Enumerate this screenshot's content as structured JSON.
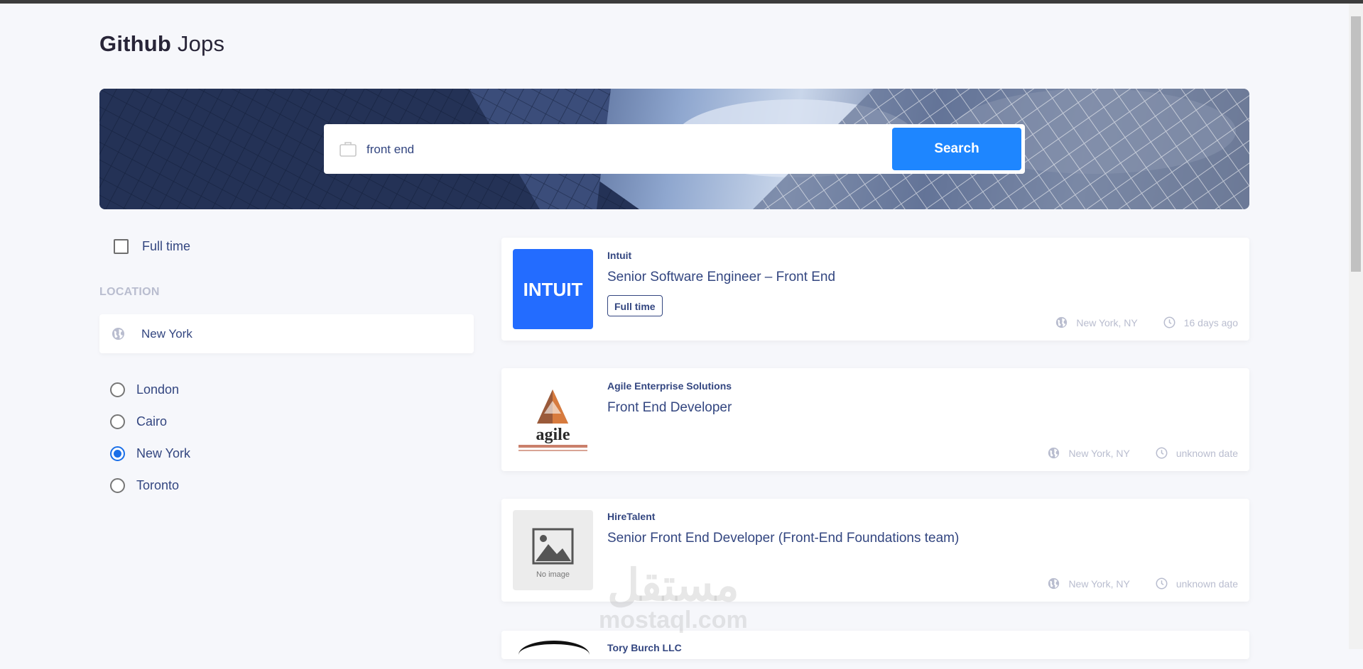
{
  "brand": {
    "bold": "Github",
    "light": "Jops"
  },
  "search": {
    "value": "front end",
    "button_label": "Search"
  },
  "filters": {
    "fulltime_label": "Full time",
    "fulltime_checked": false,
    "location_heading": "LOCATION",
    "location_value": "New York",
    "locations": [
      {
        "label": "London",
        "checked": false
      },
      {
        "label": "Cairo",
        "checked": false
      },
      {
        "label": "New York",
        "checked": true
      },
      {
        "label": "Toronto",
        "checked": false
      }
    ]
  },
  "jobs": [
    {
      "company": "Intuit",
      "title": "Senior Software Engineer – Front End",
      "tag": "Full time",
      "location": "New York, NY",
      "posted": "16 days ago",
      "logo_text": "INTUIT",
      "logo_color": "#236cff"
    },
    {
      "company": "Agile Enterprise Solutions",
      "title": "Front End Developer",
      "location": "New York, NY",
      "posted": "unknown date",
      "logo_text": "agile"
    },
    {
      "company": "HireTalent",
      "title": "Senior Front End Developer (Front-End Foundations team)",
      "location": "New York, NY",
      "posted": "unknown date",
      "logo_text": "No image"
    },
    {
      "company": "Tory Burch LLC"
    }
  ],
  "watermark": {
    "arabic": "مستقل",
    "latin": "mostaql.com"
  },
  "colors": {
    "accent": "#1e86ff",
    "text": "#334680",
    "muted": "#b9bdcf",
    "background": "#f6f7fb"
  }
}
